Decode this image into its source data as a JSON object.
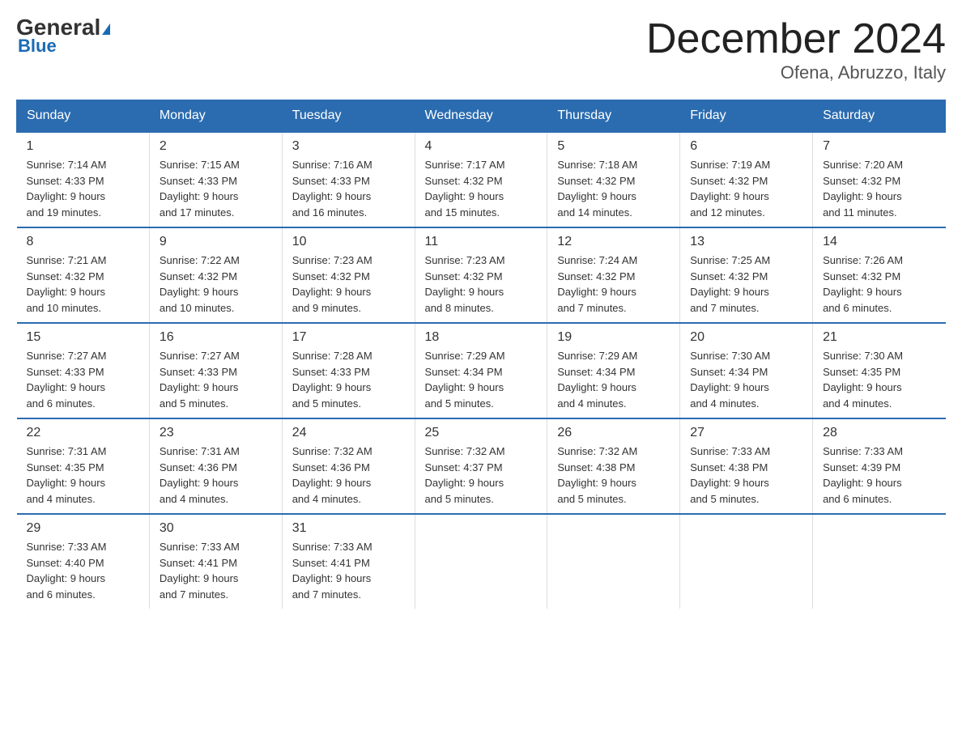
{
  "logo": {
    "general": "General",
    "blue": "Blue"
  },
  "title": "December 2024",
  "subtitle": "Ofena, Abruzzo, Italy",
  "days": [
    "Sunday",
    "Monday",
    "Tuesday",
    "Wednesday",
    "Thursday",
    "Friday",
    "Saturday"
  ],
  "weeks": [
    [
      {
        "date": "1",
        "sunrise": "7:14 AM",
        "sunset": "4:33 PM",
        "daylight": "9 hours and 19 minutes."
      },
      {
        "date": "2",
        "sunrise": "7:15 AM",
        "sunset": "4:33 PM",
        "daylight": "9 hours and 17 minutes."
      },
      {
        "date": "3",
        "sunrise": "7:16 AM",
        "sunset": "4:33 PM",
        "daylight": "9 hours and 16 minutes."
      },
      {
        "date": "4",
        "sunrise": "7:17 AM",
        "sunset": "4:32 PM",
        "daylight": "9 hours and 15 minutes."
      },
      {
        "date": "5",
        "sunrise": "7:18 AM",
        "sunset": "4:32 PM",
        "daylight": "9 hours and 14 minutes."
      },
      {
        "date": "6",
        "sunrise": "7:19 AM",
        "sunset": "4:32 PM",
        "daylight": "9 hours and 12 minutes."
      },
      {
        "date": "7",
        "sunrise": "7:20 AM",
        "sunset": "4:32 PM",
        "daylight": "9 hours and 11 minutes."
      }
    ],
    [
      {
        "date": "8",
        "sunrise": "7:21 AM",
        "sunset": "4:32 PM",
        "daylight": "9 hours and 10 minutes."
      },
      {
        "date": "9",
        "sunrise": "7:22 AM",
        "sunset": "4:32 PM",
        "daylight": "9 hours and 10 minutes."
      },
      {
        "date": "10",
        "sunrise": "7:23 AM",
        "sunset": "4:32 PM",
        "daylight": "9 hours and 9 minutes."
      },
      {
        "date": "11",
        "sunrise": "7:23 AM",
        "sunset": "4:32 PM",
        "daylight": "9 hours and 8 minutes."
      },
      {
        "date": "12",
        "sunrise": "7:24 AM",
        "sunset": "4:32 PM",
        "daylight": "9 hours and 7 minutes."
      },
      {
        "date": "13",
        "sunrise": "7:25 AM",
        "sunset": "4:32 PM",
        "daylight": "9 hours and 7 minutes."
      },
      {
        "date": "14",
        "sunrise": "7:26 AM",
        "sunset": "4:32 PM",
        "daylight": "9 hours and 6 minutes."
      }
    ],
    [
      {
        "date": "15",
        "sunrise": "7:27 AM",
        "sunset": "4:33 PM",
        "daylight": "9 hours and 6 minutes."
      },
      {
        "date": "16",
        "sunrise": "7:27 AM",
        "sunset": "4:33 PM",
        "daylight": "9 hours and 5 minutes."
      },
      {
        "date": "17",
        "sunrise": "7:28 AM",
        "sunset": "4:33 PM",
        "daylight": "9 hours and 5 minutes."
      },
      {
        "date": "18",
        "sunrise": "7:29 AM",
        "sunset": "4:34 PM",
        "daylight": "9 hours and 5 minutes."
      },
      {
        "date": "19",
        "sunrise": "7:29 AM",
        "sunset": "4:34 PM",
        "daylight": "9 hours and 4 minutes."
      },
      {
        "date": "20",
        "sunrise": "7:30 AM",
        "sunset": "4:34 PM",
        "daylight": "9 hours and 4 minutes."
      },
      {
        "date": "21",
        "sunrise": "7:30 AM",
        "sunset": "4:35 PM",
        "daylight": "9 hours and 4 minutes."
      }
    ],
    [
      {
        "date": "22",
        "sunrise": "7:31 AM",
        "sunset": "4:35 PM",
        "daylight": "9 hours and 4 minutes."
      },
      {
        "date": "23",
        "sunrise": "7:31 AM",
        "sunset": "4:36 PM",
        "daylight": "9 hours and 4 minutes."
      },
      {
        "date": "24",
        "sunrise": "7:32 AM",
        "sunset": "4:36 PM",
        "daylight": "9 hours and 4 minutes."
      },
      {
        "date": "25",
        "sunrise": "7:32 AM",
        "sunset": "4:37 PM",
        "daylight": "9 hours and 5 minutes."
      },
      {
        "date": "26",
        "sunrise": "7:32 AM",
        "sunset": "4:38 PM",
        "daylight": "9 hours and 5 minutes."
      },
      {
        "date": "27",
        "sunrise": "7:33 AM",
        "sunset": "4:38 PM",
        "daylight": "9 hours and 5 minutes."
      },
      {
        "date": "28",
        "sunrise": "7:33 AM",
        "sunset": "4:39 PM",
        "daylight": "9 hours and 6 minutes."
      }
    ],
    [
      {
        "date": "29",
        "sunrise": "7:33 AM",
        "sunset": "4:40 PM",
        "daylight": "9 hours and 6 minutes."
      },
      {
        "date": "30",
        "sunrise": "7:33 AM",
        "sunset": "4:41 PM",
        "daylight": "9 hours and 7 minutes."
      },
      {
        "date": "31",
        "sunrise": "7:33 AM",
        "sunset": "4:41 PM",
        "daylight": "9 hours and 7 minutes."
      },
      null,
      null,
      null,
      null
    ]
  ],
  "labels": {
    "sunrise": "Sunrise:",
    "sunset": "Sunset:",
    "daylight": "Daylight:"
  }
}
